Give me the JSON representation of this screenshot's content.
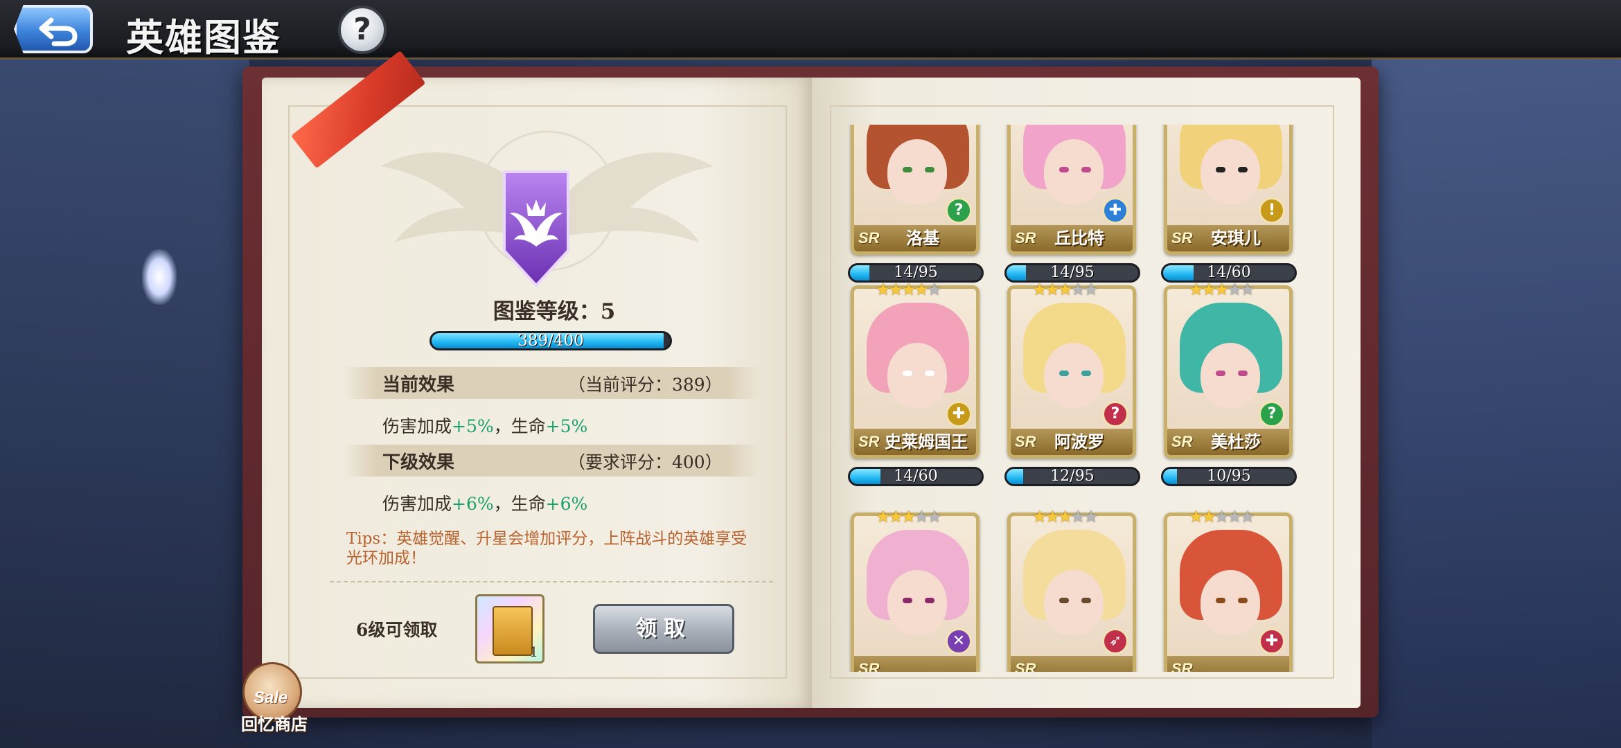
{
  "header": {
    "title": "英雄图鉴",
    "help_label": "?"
  },
  "codex": {
    "level_label": "图鉴等级：5",
    "exp_text": "389/400",
    "exp_progress": 0.9725,
    "current": {
      "title": "当前效果",
      "score": "（当前评分：389）",
      "effect_prefix": "伤害加成",
      "effect_dmg": "+5%",
      "effect_mid": "，生命",
      "effect_hp": "+5%"
    },
    "next": {
      "title": "下级效果",
      "score": "（要求评分：400）",
      "effect_prefix": "伤害加成",
      "effect_dmg": "+6%",
      "effect_mid": "，生命",
      "effect_hp": "+6%"
    },
    "tips": "Tips：英雄觉醒、升星会增加评分，上阵战斗的英雄享受光环加成！",
    "unlock_label": "6级可领取",
    "reward_count": "1",
    "claim_label": "领取"
  },
  "shop": {
    "badge": "Sale",
    "label": "回忆商店"
  },
  "heroes": [
    {
      "name": "洛基",
      "rarity": "SR",
      "stars": 0,
      "progress": "14/95",
      "ratio": 0.147,
      "class_icon": "?",
      "class_color": "#2aa14a",
      "hair": "#b4532f",
      "eye": "#3f8c3f"
    },
    {
      "name": "丘比特",
      "rarity": "SR",
      "stars": 0,
      "progress": "14/95",
      "ratio": 0.147,
      "class_icon": "✚",
      "class_color": "#2d7fd8",
      "hair": "#f2a3c9",
      "eye": "#c04a8c"
    },
    {
      "name": "安琪儿",
      "rarity": "SR",
      "stars": 0,
      "progress": "14/60",
      "ratio": 0.233,
      "class_icon": "!",
      "class_color": "#c79a1a",
      "hair": "#f1d27a",
      "eye": "#222222"
    },
    {
      "name": "史莱姆国王",
      "rarity": "SR",
      "stars": 4,
      "progress": "14/60",
      "ratio": 0.233,
      "class_icon": "✚",
      "class_color": "#c79a1a",
      "hair": "#f2a3b9",
      "eye": "#ffffff"
    },
    {
      "name": "阿波罗",
      "rarity": "SR",
      "stars": 3,
      "progress": "12/95",
      "ratio": 0.126,
      "class_icon": "?",
      "class_color": "#c0304a",
      "hair": "#f3d98a",
      "eye": "#3aa0a0"
    },
    {
      "name": "美杜莎",
      "rarity": "SR",
      "stars": 3,
      "progress": "10/95",
      "ratio": 0.105,
      "class_icon": "?",
      "class_color": "#2aa14a",
      "hair": "#3fb6a6",
      "eye": "#c04a8c"
    },
    {
      "name": "",
      "rarity": "SR",
      "stars": 3,
      "progress": "",
      "ratio": 0,
      "class_icon": "✕",
      "class_color": "#7a3fb0",
      "hair": "#f0b0d0",
      "eye": "#8a2a6a"
    },
    {
      "name": "",
      "rarity": "SR",
      "stars": 3,
      "progress": "",
      "ratio": 0,
      "class_icon": "➶",
      "class_color": "#c0304a",
      "hair": "#f3dc9c",
      "eye": "#6a4a2a"
    },
    {
      "name": "",
      "rarity": "SR",
      "stars": 2,
      "progress": "",
      "ratio": 0,
      "class_icon": "✚",
      "class_color": "#c0304a",
      "hair": "#d8553a",
      "eye": "#8a4a1a"
    }
  ]
}
